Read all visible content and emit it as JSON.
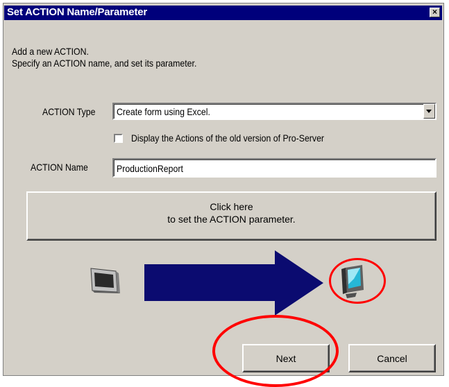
{
  "dialog": {
    "title": "Set ACTION Name/Parameter",
    "close_glyph": "×",
    "intro_line1": "Add a new ACTION.",
    "intro_line2": "Specify an ACTION name, and set its parameter.",
    "action_type_label": "ACTION Type",
    "action_type_value": "Create form using Excel.",
    "old_version_checkbox_label": "Display the Actions of the old version of Pro-Server",
    "old_version_checked": false,
    "action_name_label": "ACTION Name",
    "action_name_value": "ProductionReport",
    "param_button_line1": "Click here",
    "param_button_line2": "to set the ACTION parameter.",
    "next_label": "Next",
    "cancel_label": "Cancel"
  },
  "colors": {
    "titlebar": "#00007b",
    "arrow": "#0b0b70",
    "highlight": "#ff0000",
    "window_face": "#d4d0c8"
  },
  "icons": {
    "source": "display-panel-icon",
    "destination": "pc-monitor-icon",
    "flow": "right-arrow"
  }
}
